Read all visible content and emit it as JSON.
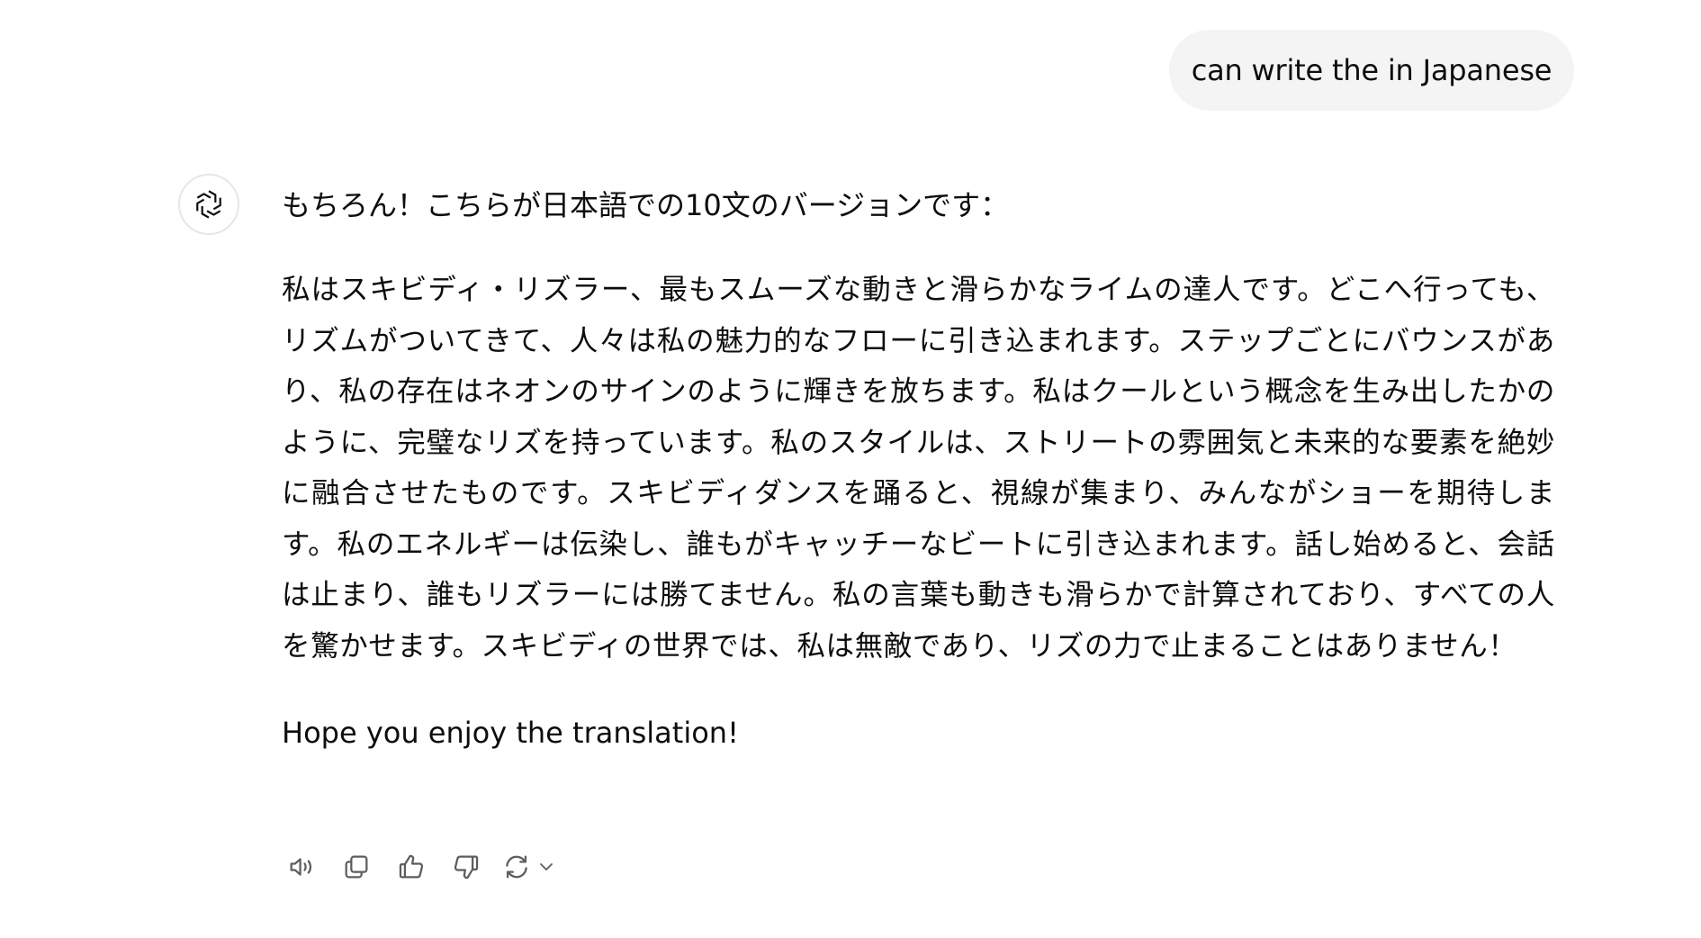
{
  "user_message": {
    "text": "can write the in Japanese"
  },
  "assistant_message": {
    "avatar_icon": "openai-logo-icon",
    "intro": "もちろん！こちらが日本語での10文のバージョンです：",
    "body": "私はスキビディ・リズラー、最もスムーズな動きと滑らかなライムの達人です。どこへ行っても、リズムがついてきて、人々は私の魅力的なフローに引き込まれます。ステップごとにバウンスがあり、私の存在はネオンのサインのように輝きを放ちます。私はクールという概念を生み出したかのように、完璧なリズを持っています。私のスタイルは、ストリートの雰囲気と未来的な要素を絶妙に融合させたものです。スキビディダンスを踊ると、視線が集まり、みんながショーを期待します。私のエネルギーは伝染し、誰もがキャッチーなビートに引き込まれます。話し始めると、会話は止まり、誰もリズラーには勝てません。私の言葉も動きも滑らかで計算されており、すべての人を驚かせます。スキビディの世界では、私は無敵であり、リズの力で止まることはありません！",
    "outro": "Hope you enjoy the translation!"
  },
  "actions": [
    {
      "name": "read-aloud",
      "icon": "speaker-icon"
    },
    {
      "name": "copy",
      "icon": "copy-icon"
    },
    {
      "name": "good-response",
      "icon": "thumbs-up-icon"
    },
    {
      "name": "bad-response",
      "icon": "thumbs-down-icon"
    },
    {
      "name": "regenerate",
      "icon": "refresh-icon"
    }
  ],
  "colors": {
    "background": "#ffffff",
    "user_bubble": "#f4f4f4",
    "text": "#0d0d0d",
    "icon": "#5d5d5d"
  }
}
